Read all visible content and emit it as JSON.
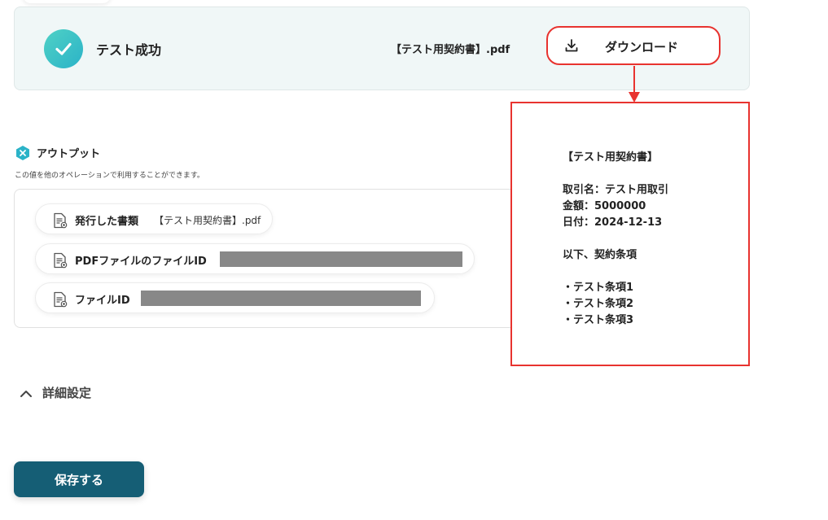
{
  "result": {
    "status_label": "テスト成功",
    "file_name": "【テスト用契約書】.pdf",
    "download_label": "ダウンロード"
  },
  "output": {
    "title": "アウトプット",
    "description": "この値を他のオペレーションで利用することができます。",
    "items": [
      {
        "label": "発行した書類",
        "value": "【テスト用契約書】.pdf",
        "redacted": false
      },
      {
        "label": "PDFファイルのファイルID",
        "value": "",
        "redacted": true
      },
      {
        "label": "ファイルID",
        "value": "",
        "redacted": true
      }
    ]
  },
  "preview": {
    "lines": [
      "【テスト用契約書】",
      "",
      "取引名：テスト用取引",
      "金額：5000000",
      "日付：2024-12-13",
      "",
      "以下、契約条項",
      "",
      "・テスト条項1",
      "・テスト条項2",
      "・テスト条項3"
    ]
  },
  "advanced_label": "詳細設定",
  "save_label": "保存する",
  "colors": {
    "accent_teal": "#2bb3c8",
    "highlight_red": "#e8332f",
    "save_button": "#155e75",
    "redaction_gray": "#888888"
  },
  "icons": {
    "status": "check-circle-icon",
    "download": "download-icon",
    "output": "output-x-icon",
    "document": "document-icon",
    "advanced": "chevron-up-icon"
  }
}
